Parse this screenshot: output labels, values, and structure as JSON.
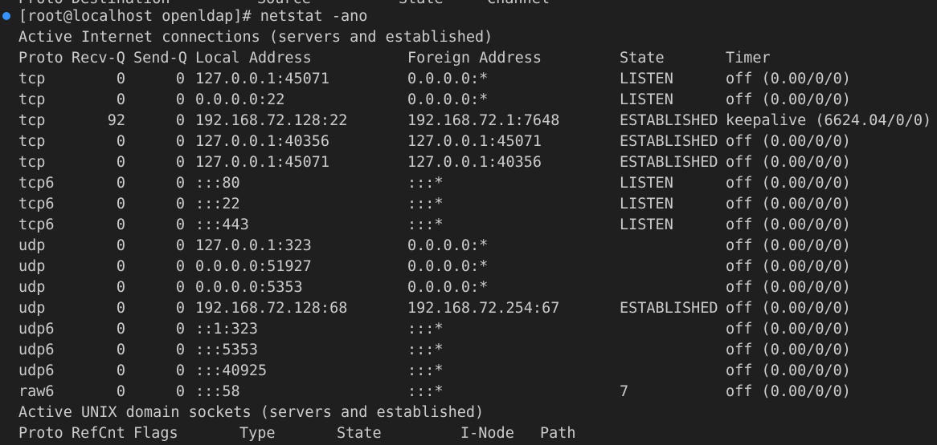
{
  "terminal": {
    "top_partial": {
      "proto": "Proto",
      "destination": "Destination",
      "source": "Source",
      "state": "State",
      "channel": "Channel"
    },
    "prompt": "[root@localhost openldap]# netstat -ano",
    "inet_title": "Active Internet connections (servers and established)",
    "inet_headers": {
      "proto": "Proto",
      "recvq": "Recv-Q",
      "sendq": "Send-Q",
      "local": "Local Address",
      "foreign": "Foreign Address",
      "state": "State",
      "timer": "Timer"
    },
    "inet_rows": [
      {
        "proto": "tcp",
        "recvq": "0",
        "sendq": "0",
        "local": "127.0.0.1:45071",
        "foreign": "0.0.0.0:*",
        "state": "LISTEN",
        "timer": "off (0.00/0/0)"
      },
      {
        "proto": "tcp",
        "recvq": "0",
        "sendq": "0",
        "local": "0.0.0.0:22",
        "foreign": "0.0.0.0:*",
        "state": "LISTEN",
        "timer": "off (0.00/0/0)"
      },
      {
        "proto": "tcp",
        "recvq": "92",
        "sendq": "0",
        "local": "192.168.72.128:22",
        "foreign": "192.168.72.1:7648",
        "state": "ESTABLISHED",
        "timer": "keepalive (6624.04/0/0)"
      },
      {
        "proto": "tcp",
        "recvq": "0",
        "sendq": "0",
        "local": "127.0.0.1:40356",
        "foreign": "127.0.0.1:45071",
        "state": "ESTABLISHED",
        "timer": "off (0.00/0/0)"
      },
      {
        "proto": "tcp",
        "recvq": "0",
        "sendq": "0",
        "local": "127.0.0.1:45071",
        "foreign": "127.0.0.1:40356",
        "state": "ESTABLISHED",
        "timer": "off (0.00/0/0)"
      },
      {
        "proto": "tcp6",
        "recvq": "0",
        "sendq": "0",
        "local": ":::80",
        "foreign": ":::*",
        "state": "LISTEN",
        "timer": "off (0.00/0/0)"
      },
      {
        "proto": "tcp6",
        "recvq": "0",
        "sendq": "0",
        "local": ":::22",
        "foreign": ":::*",
        "state": "LISTEN",
        "timer": "off (0.00/0/0)"
      },
      {
        "proto": "tcp6",
        "recvq": "0",
        "sendq": "0",
        "local": ":::443",
        "foreign": ":::*",
        "state": "LISTEN",
        "timer": "off (0.00/0/0)"
      },
      {
        "proto": "udp",
        "recvq": "0",
        "sendq": "0",
        "local": "127.0.0.1:323",
        "foreign": "0.0.0.0:*",
        "state": "",
        "timer": "off (0.00/0/0)"
      },
      {
        "proto": "udp",
        "recvq": "0",
        "sendq": "0",
        "local": "0.0.0.0:51927",
        "foreign": "0.0.0.0:*",
        "state": "",
        "timer": "off (0.00/0/0)"
      },
      {
        "proto": "udp",
        "recvq": "0",
        "sendq": "0",
        "local": "0.0.0.0:5353",
        "foreign": "0.0.0.0:*",
        "state": "",
        "timer": "off (0.00/0/0)"
      },
      {
        "proto": "udp",
        "recvq": "0",
        "sendq": "0",
        "local": "192.168.72.128:68",
        "foreign": "192.168.72.254:67",
        "state": "ESTABLISHED",
        "timer": "off (0.00/0/0)"
      },
      {
        "proto": "udp6",
        "recvq": "0",
        "sendq": "0",
        "local": "::1:323",
        "foreign": ":::*",
        "state": "",
        "timer": "off (0.00/0/0)"
      },
      {
        "proto": "udp6",
        "recvq": "0",
        "sendq": "0",
        "local": ":::5353",
        "foreign": ":::*",
        "state": "",
        "timer": "off (0.00/0/0)"
      },
      {
        "proto": "udp6",
        "recvq": "0",
        "sendq": "0",
        "local": ":::40925",
        "foreign": ":::*",
        "state": "",
        "timer": "off (0.00/0/0)"
      },
      {
        "proto": "raw6",
        "recvq": "0",
        "sendq": "0",
        "local": ":::58",
        "foreign": ":::*",
        "state": "7",
        "timer": "off (0.00/0/0)"
      }
    ],
    "unix_title": "Active UNIX domain sockets (servers and established)",
    "unix_headers": {
      "proto": "Proto",
      "refcnt": "RefCnt",
      "flags": "Flags",
      "type": "Type",
      "state": "State",
      "inode": "I-Node",
      "path": "Path"
    },
    "colors": {
      "background": "#1f1f1f",
      "text": "#cccccc",
      "prompt_dot": "#3794ff"
    }
  }
}
